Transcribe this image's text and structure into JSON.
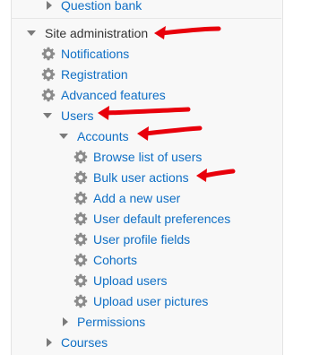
{
  "nav": {
    "question_bank": "Question bank",
    "site_administration": "Site administration",
    "notifications": "Notifications",
    "registration": "Registration",
    "advanced_features": "Advanced features",
    "users": "Users",
    "accounts": "Accounts",
    "browse_list_of_users": "Browse list of users",
    "bulk_user_actions": "Bulk user actions",
    "add_a_new_user": "Add a new user",
    "user_default_preferences": "User default preferences",
    "user_profile_fields": "User profile fields",
    "cohorts": "Cohorts",
    "upload_users": "Upload users",
    "upload_user_pictures": "Upload user pictures",
    "permissions": "Permissions",
    "courses": "Courses"
  },
  "icons": {
    "expand": "triangle-right-icon",
    "collapse": "triangle-down-icon",
    "settings": "gear-icon",
    "annotation": "red-arrow-icon"
  },
  "colors": {
    "link": "#0f6fc5",
    "text": "#333333",
    "annotation_arrow": "#e8000b"
  }
}
